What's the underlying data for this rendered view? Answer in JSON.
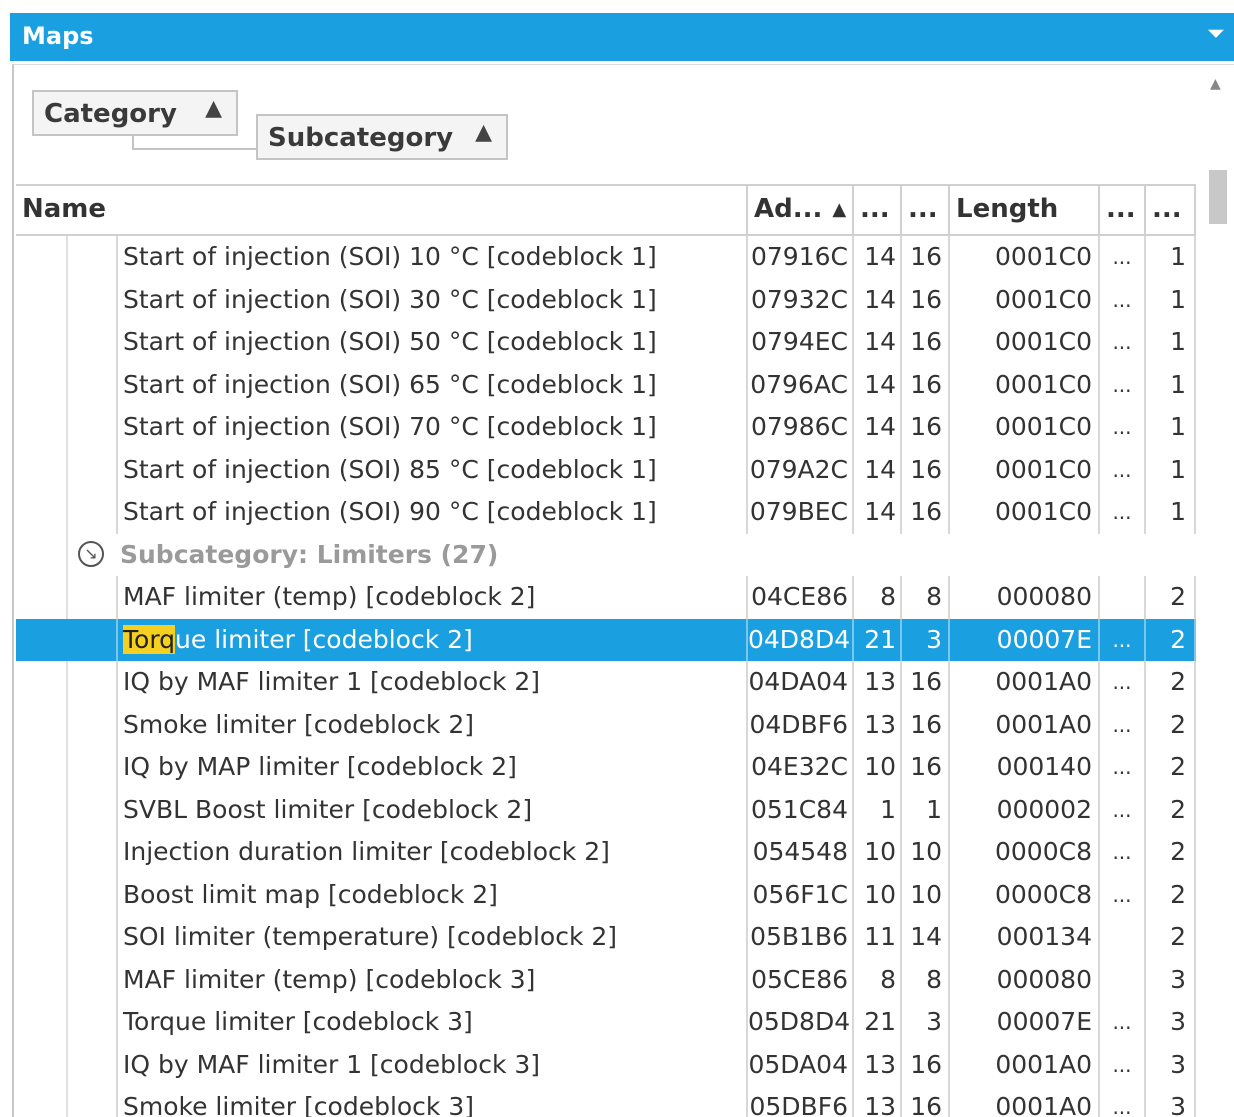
{
  "window": {
    "title": "Maps",
    "pin_icon": "pin-icon"
  },
  "grouping": {
    "chips": [
      {
        "label": "Category",
        "sort": "▲"
      },
      {
        "label": "Subcategory",
        "sort": "▲"
      }
    ]
  },
  "columns": {
    "name": "Name",
    "address": "Ad...",
    "address_sort": "▲",
    "col1": "...",
    "col2": "...",
    "length": "Length",
    "col3": "...",
    "col4": "..."
  },
  "group_rows": [
    {
      "label": "Subcategory: Limiters (27)",
      "icon": "collapse-circle-icon"
    }
  ],
  "rows": [
    {
      "name": "Start of injection (SOI) 10 °C [codeblock 1]",
      "address": "07916C",
      "c1": "14",
      "c2": "16",
      "length": "0001C0",
      "c3": "...",
      "c4": "1"
    },
    {
      "name": "Start of injection (SOI) 30 °C [codeblock 1]",
      "address": "07932C",
      "c1": "14",
      "c2": "16",
      "length": "0001C0",
      "c3": "...",
      "c4": "1"
    },
    {
      "name": "Start of injection (SOI) 50 °C [codeblock 1]",
      "address": "0794EC",
      "c1": "14",
      "c2": "16",
      "length": "0001C0",
      "c3": "...",
      "c4": "1"
    },
    {
      "name": "Start of injection (SOI) 65 °C [codeblock 1]",
      "address": "0796AC",
      "c1": "14",
      "c2": "16",
      "length": "0001C0",
      "c3": "...",
      "c4": "1"
    },
    {
      "name": "Start of injection (SOI) 70 °C [codeblock 1]",
      "address": "07986C",
      "c1": "14",
      "c2": "16",
      "length": "0001C0",
      "c3": "...",
      "c4": "1"
    },
    {
      "name": "Start of injection (SOI) 85 °C [codeblock 1]",
      "address": "079A2C",
      "c1": "14",
      "c2": "16",
      "length": "0001C0",
      "c3": "...",
      "c4": "1"
    },
    {
      "name": "Start of injection (SOI) 90 °C [codeblock 1]",
      "address": "079BEC",
      "c1": "14",
      "c2": "16",
      "length": "0001C0",
      "c3": "...",
      "c4": "1"
    },
    {
      "name": "MAF limiter (temp) [codeblock 2]",
      "address": "04CE86",
      "c1": "8",
      "c2": "8",
      "length": "000080",
      "c3": "",
      "c4": "2"
    },
    {
      "name_hl": "Torq",
      "name_rest": "ue limiter [codeblock 2]",
      "address": "04D8D4",
      "c1": "21",
      "c2": "3",
      "length": "00007E",
      "c3": "...",
      "c4": "2",
      "selected": true
    },
    {
      "name": "IQ by MAF limiter 1 [codeblock 2]",
      "address": "04DA04",
      "c1": "13",
      "c2": "16",
      "length": "0001A0",
      "c3": "...",
      "c4": "2"
    },
    {
      "name": "Smoke limiter [codeblock 2]",
      "address": "04DBF6",
      "c1": "13",
      "c2": "16",
      "length": "0001A0",
      "c3": "...",
      "c4": "2"
    },
    {
      "name": "IQ by MAP limiter [codeblock 2]",
      "address": "04E32C",
      "c1": "10",
      "c2": "16",
      "length": "000140",
      "c3": "...",
      "c4": "2"
    },
    {
      "name": "SVBL Boost limiter [codeblock 2]",
      "address": "051C84",
      "c1": "1",
      "c2": "1",
      "length": "000002",
      "c3": "...",
      "c4": "2"
    },
    {
      "name": "Injection duration limiter [codeblock 2]",
      "address": "054548",
      "c1": "10",
      "c2": "10",
      "length": "0000C8",
      "c3": "...",
      "c4": "2"
    },
    {
      "name": "Boost limit map [codeblock 2]",
      "address": "056F1C",
      "c1": "10",
      "c2": "10",
      "length": "0000C8",
      "c3": "...",
      "c4": "2"
    },
    {
      "name": "SOI limiter (temperature) [codeblock 2]",
      "address": "05B1B6",
      "c1": "11",
      "c2": "14",
      "length": "000134",
      "c3": "",
      "c4": "2"
    },
    {
      "name": "MAF limiter (temp) [codeblock 3]",
      "address": "05CE86",
      "c1": "8",
      "c2": "8",
      "length": "000080",
      "c3": "",
      "c4": "3"
    },
    {
      "name": "Torque limiter [codeblock 3]",
      "address": "05D8D4",
      "c1": "21",
      "c2": "3",
      "length": "00007E",
      "c3": "...",
      "c4": "3"
    },
    {
      "name": "IQ by MAF limiter 1 [codeblock 3]",
      "address": "05DA04",
      "c1": "13",
      "c2": "16",
      "length": "0001A0",
      "c3": "...",
      "c4": "3"
    },
    {
      "name": "Smoke limiter [codeblock 3]",
      "address": "05DBF6",
      "c1": "13",
      "c2": "16",
      "length": "0001A0",
      "c3": "...",
      "c4": "3"
    }
  ]
}
